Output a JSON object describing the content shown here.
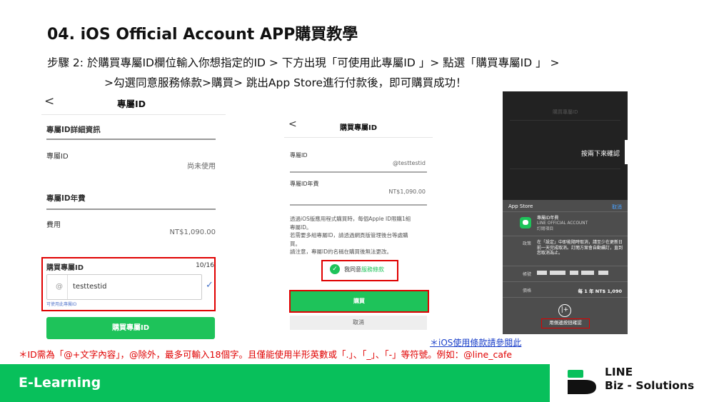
{
  "page": {
    "title": "04. iOS Official Account APP購買教學",
    "step_line1": "步驟 2:  於購買專屬ID欄位輸入你想指定的ID > 下方出現「可使用此專屬ID 」> 點選「購買專屬ID 」 >",
    "step_line2": ">勾選同意服務條款>購買> 跳出App Store進行付款後，即可購買成功！"
  },
  "panel1": {
    "back": "<",
    "header": "專屬ID",
    "section_details": "專屬ID詳細資訊",
    "id_label": "專屬ID",
    "id_value": "尚未使用",
    "section_fee": "專屬ID年費",
    "fee_label": "費用",
    "fee_value": "NT$1,090.00",
    "buy_label": "購買專屬ID",
    "char_count": "10/16",
    "input_prefix": "@",
    "input_value": "testtestid",
    "available_hint": "可使用此專屬ID",
    "buy_button": "購買專屬ID"
  },
  "panel2": {
    "back": "<",
    "header": "購買專屬ID",
    "id_label": "專屬ID",
    "id_value": "@testtestid",
    "fee_label": "專屬ID年費",
    "fee_value": "NT$1,090.00",
    "note_lines": [
      "透過iOS版應用程式購買時，每個Apple ID限購1組",
      "專屬ID。",
      "若需要多組專屬ID，請透過網頁版管理後台等處購",
      "買。",
      "請注意，專屬ID的名稱在購買後無法更改。"
    ],
    "agree_prefix": "我同意",
    "agree_link": "服務條款",
    "buy_button": "購買",
    "cancel_button": "取消"
  },
  "panel3": {
    "dim_header": "購買專屬ID",
    "double_click": "按兩下來確認",
    "appstore_label": "App Store",
    "cancel": "取消",
    "product_line1": "專屬ID年費",
    "product_line2": "LINE OFFICIAL ACCOUNT",
    "product_line3": "訂閱項目",
    "policy_label": "政策",
    "policy_text": "在「設定」中即能隨時取消，請至少在更新日前一天完成取消。訂閱方案會自動續訂，直到您取消為止。",
    "account_label": "帳號",
    "price_label": "價格",
    "price_value": "每 1 年 NT$ 1,090",
    "side_icon": "|+",
    "confirm_hint": "用側邊按鈕確認"
  },
  "tos_link": "＊iOS使用條款請參閱此",
  "footnote": "＊ID需為「@+文字內容」，@除外，最多可輸入18個字。且僅能使用半形英數或「.」、「_」、「-」等符號。例如：@line_cafe",
  "footer": {
    "label": "E-Learning",
    "logo_line1": "LINE",
    "logo_line2": "Biz - Solutions"
  },
  "colors": {
    "line_green": "#08c05b",
    "button_green": "#1ec35a",
    "highlight_red": "#e00000",
    "link_blue": "#1a3fc9"
  }
}
